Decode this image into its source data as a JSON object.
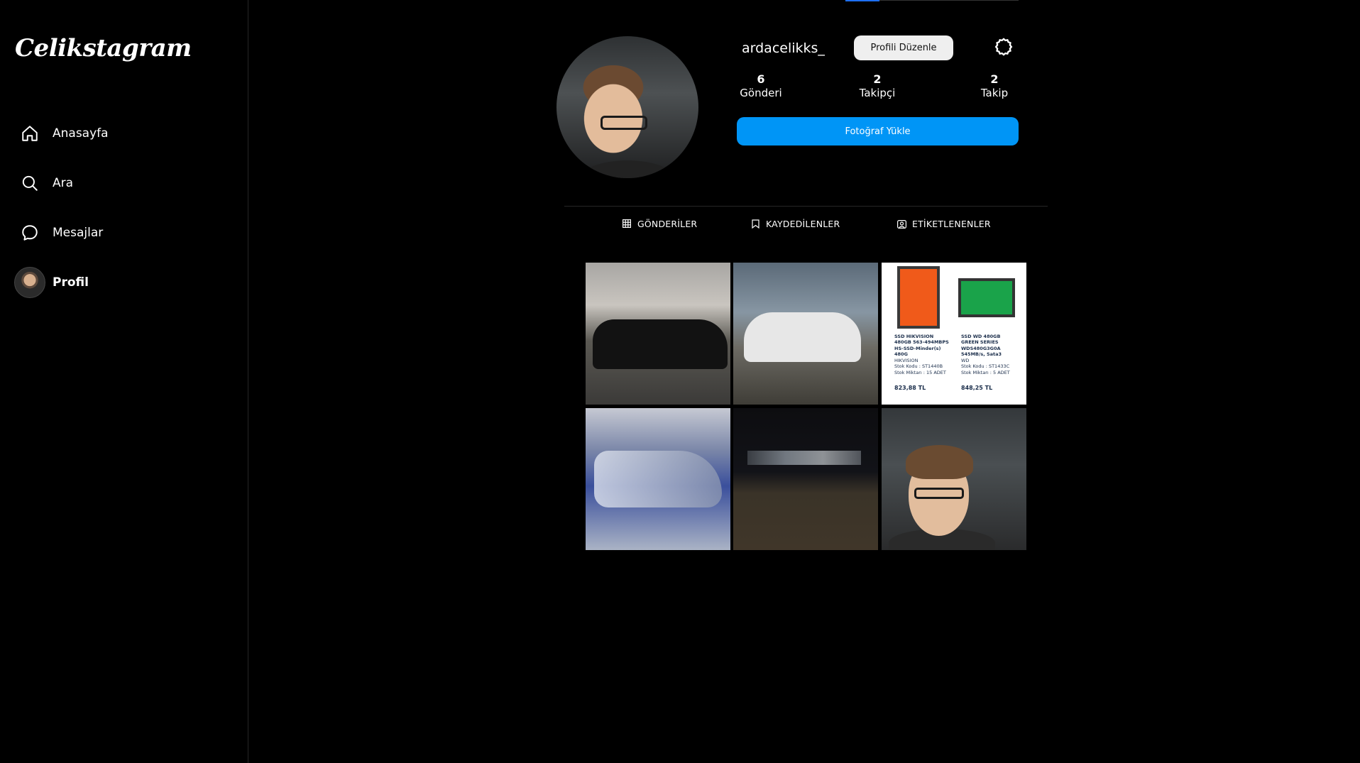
{
  "app": {
    "logo": "Celikstagram"
  },
  "sidebar": {
    "items": [
      {
        "label": "Anasayfa",
        "icon": "home-icon"
      },
      {
        "label": "Ara",
        "icon": "search-icon"
      },
      {
        "label": "Mesajlar",
        "icon": "messages-icon"
      },
      {
        "label": "Profil",
        "icon": "avatar"
      }
    ]
  },
  "profile": {
    "username": "ardacelikks_",
    "edit_label": "Profili Düzenle",
    "upload_label": "Fotoğraf Yükle",
    "stats": [
      {
        "value": "6",
        "label": "Gönderi"
      },
      {
        "value": "2",
        "label": "Takipçi"
      },
      {
        "value": "2",
        "label": "Takip"
      }
    ]
  },
  "tabs": [
    {
      "label": "GÖNDERİLER",
      "icon": "grid-icon"
    },
    {
      "label": "KAYDEDİLENLER",
      "icon": "bookmark-icon"
    },
    {
      "label": "ETİKETLENENLER",
      "icon": "tag-person-icon"
    }
  ],
  "posts": {
    "ssd_left": {
      "brand": "HIKVISION",
      "title": "SSD HIKVISION 480GB 563-494MBPS HS-SSD-Minder(s) 480G",
      "stock_code": "Stok Kodu : ST1440B",
      "stock_qty": "Stok Miktarı : 15 ADET",
      "price": "823,88 TL"
    },
    "ssd_right": {
      "brand": "WD",
      "title": "SSD WD 480GB GREEN SERIES WDS480G3G0A 545MB/s, Sata3",
      "stock_code": "Stok Kodu : ST1433C",
      "stock_qty": "Stok Miktarı : 5 ADET",
      "price": "848,25 TL"
    }
  },
  "colors": {
    "accent": "#0095f6",
    "background": "#000000",
    "divider": "#262626"
  }
}
